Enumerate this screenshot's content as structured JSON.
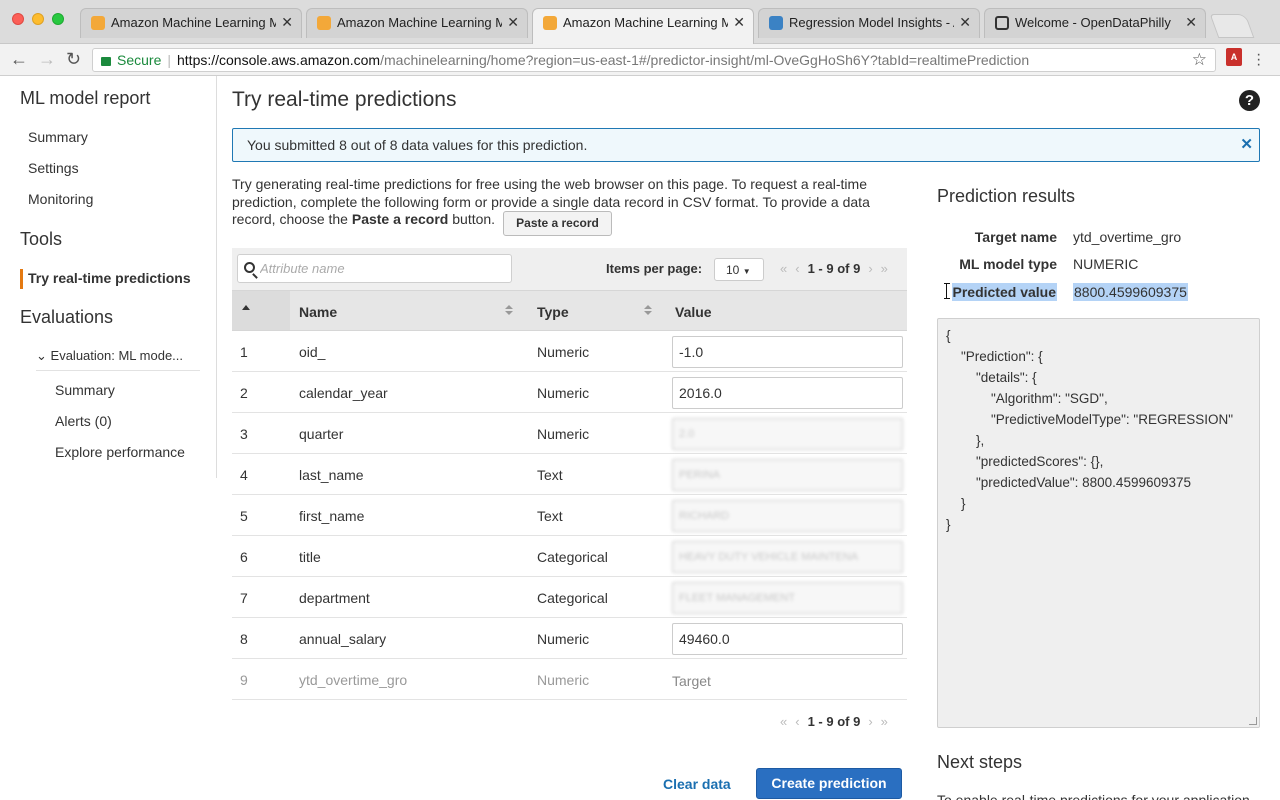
{
  "browser": {
    "tabs": [
      {
        "title": "Amazon Machine Learning Ma",
        "favicon": "aws"
      },
      {
        "title": "Amazon Machine Learning Ma",
        "favicon": "aws"
      },
      {
        "title": "Amazon Machine Learning Ma",
        "favicon": "aws"
      },
      {
        "title": "Regression Model Insights - A",
        "favicon": "doc"
      },
      {
        "title": "Welcome - OpenDataPhilly",
        "favicon": "opendataphilly"
      }
    ],
    "active_tab": 2,
    "security_label": "Secure",
    "url_host": "https://console.aws.amazon.com",
    "url_rest": "/machinelearning/home?region=us-east-1#/predictor-insight/ml-OveGgHoSh6Y?tabId=realtimePrediction"
  },
  "sidebar": {
    "report_heading": "ML model report",
    "report_items": [
      "Summary",
      "Settings",
      "Monitoring"
    ],
    "tools_heading": "Tools",
    "tools_item": "Try real-time predictions",
    "evaluations_heading": "Evaluations",
    "evaluation_name": "Evaluation: ML mode...",
    "evaluation_items": [
      "Summary",
      "Alerts (0)",
      "Explore performance"
    ]
  },
  "main": {
    "title": "Try real-time predictions",
    "alert": "You submitted 8 out of 8 data values for this prediction.",
    "intro_before": "Try generating real-time predictions for free using the web browser on this page. To request a real-time prediction, complete the following form or provide a single data record in CSV format. To provide a data record, choose the ",
    "intro_bold": "Paste a record",
    "intro_after": " button.",
    "paste_button": "Paste a record",
    "search_placeholder": "Attribute name",
    "items_per_page_label": "Items per page:",
    "items_per_page_value": "10",
    "pagination_text": "1 - 9 of 9",
    "columns": {
      "name": "Name",
      "type": "Type",
      "value": "Value"
    },
    "rows": [
      {
        "num": "1",
        "name": "oid_",
        "type": "Numeric",
        "value": "-1.0"
      },
      {
        "num": "2",
        "name": "calendar_year",
        "type": "Numeric",
        "value": "2016.0"
      },
      {
        "num": "3",
        "name": "quarter",
        "type": "Numeric",
        "value": "2.0"
      },
      {
        "num": "4",
        "name": "last_name",
        "type": "Text",
        "value": "PERINA"
      },
      {
        "num": "5",
        "name": "first_name",
        "type": "Text",
        "value": "RICHARD"
      },
      {
        "num": "6",
        "name": "title",
        "type": "Categorical",
        "value": "HEAVY DUTY VEHICLE MAINTENA"
      },
      {
        "num": "7",
        "name": "department",
        "type": "Categorical",
        "value": "FLEET MANAGEMENT"
      },
      {
        "num": "8",
        "name": "annual_salary",
        "type": "Numeric",
        "value": "49460.0"
      }
    ],
    "target_row": {
      "num": "9",
      "name": "ytd_overtime_gro",
      "type": "Numeric",
      "value": "Target"
    },
    "clear_label": "Clear data",
    "create_label": "Create prediction"
  },
  "results": {
    "title": "Prediction results",
    "target_name_label": "Target name",
    "target_name_value": "ytd_overtime_gro",
    "model_type_label": "ML model type",
    "model_type_value": "NUMERIC",
    "predicted_label": "Predicted value",
    "predicted_value": "8800.4599609375",
    "json": "{\n    \"Prediction\": {\n        \"details\": {\n            \"Algorithm\": \"SGD\",\n            \"PredictiveModelType\": \"REGRESSION\"\n        },\n        \"predictedScores\": {},\n        \"predictedValue\": 8800.4599609375\n    }\n}",
    "next_title": "Next steps",
    "next_text": "To enable real-time predictions for your application,"
  }
}
